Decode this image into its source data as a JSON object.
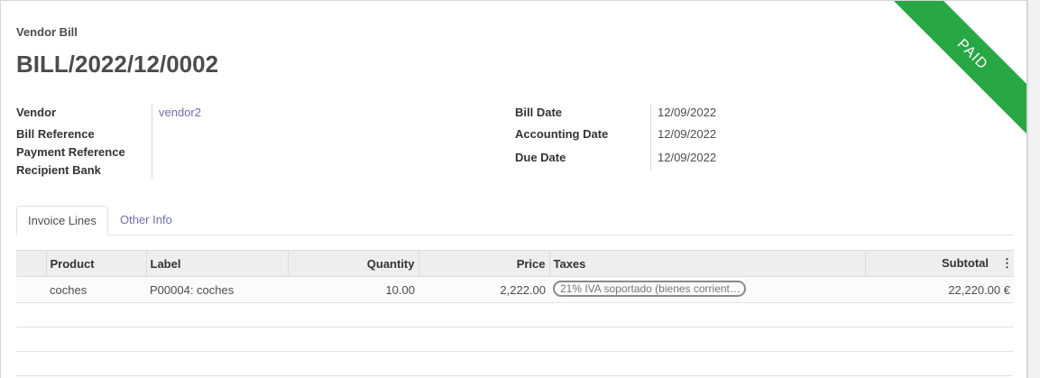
{
  "ribbon": "PAID",
  "header": {
    "doc_type": "Vendor Bill",
    "doc_name": "BILL/2022/12/0002"
  },
  "left_fields": {
    "vendor_label": "Vendor",
    "vendor_value": "vendor2",
    "bill_ref_label": "Bill Reference",
    "bill_ref_value": "",
    "payment_ref_label": "Payment Reference",
    "payment_ref_value": "",
    "recipient_bank_label": "Recipient Bank",
    "recipient_bank_value": ""
  },
  "right_fields": {
    "bill_date_label": "Bill Date",
    "bill_date_value": "12/09/2022",
    "accounting_date_label": "Accounting Date",
    "accounting_date_value": "12/09/2022",
    "due_date_label": "Due Date",
    "due_date_value": "12/09/2022"
  },
  "tabs": {
    "invoice_lines": "Invoice Lines",
    "other_info": "Other Info"
  },
  "table": {
    "columns": {
      "product": "Product",
      "label": "Label",
      "quantity": "Quantity",
      "price": "Price",
      "taxes": "Taxes",
      "subtotal": "Subtotal"
    },
    "rows": [
      {
        "product": "coches",
        "label": "P00004: coches",
        "quantity": "10.00",
        "price": "2,222.00",
        "taxes": "21% IVA soportado (bienes corrient…",
        "subtotal": "22,220.00 €"
      }
    ]
  },
  "colors": {
    "ribbon": "#28a745",
    "link": "#6f6fb0"
  },
  "icons": {
    "column_options": "kebab-icon"
  }
}
